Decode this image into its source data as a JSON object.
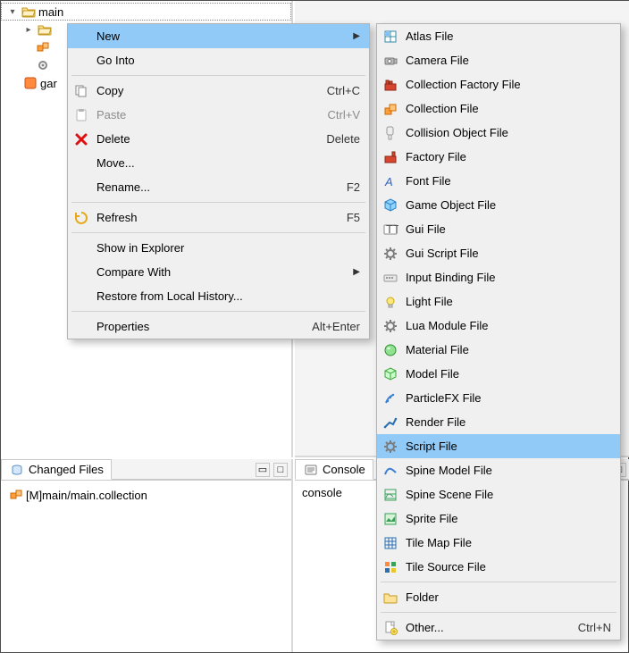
{
  "tree": {
    "main_label": "main",
    "truncated_item": "gar"
  },
  "changed": {
    "title": "Changed Files",
    "item": "[M]main/main.collection"
  },
  "console": {
    "title": "Console",
    "body": "console"
  },
  "menu_a": [
    {
      "kind": "item",
      "icon": "blank",
      "label": "New",
      "accel": "",
      "arrow": true,
      "hl": true
    },
    {
      "kind": "item",
      "icon": "blank",
      "label": "Go Into",
      "accel": "",
      "arrow": false
    },
    {
      "kind": "sep"
    },
    {
      "kind": "item",
      "icon": "copy",
      "label": "Copy",
      "accel": "Ctrl+C",
      "arrow": false
    },
    {
      "kind": "item",
      "icon": "paste",
      "label": "Paste",
      "accel": "Ctrl+V",
      "arrow": false,
      "disabled": true
    },
    {
      "kind": "item",
      "icon": "delete",
      "label": "Delete",
      "accel": "Delete",
      "arrow": false
    },
    {
      "kind": "item",
      "icon": "blank",
      "label": "Move...",
      "accel": "",
      "arrow": false
    },
    {
      "kind": "item",
      "icon": "blank",
      "label": "Rename...",
      "accel": "F2",
      "arrow": false
    },
    {
      "kind": "sep"
    },
    {
      "kind": "item",
      "icon": "refresh",
      "label": "Refresh",
      "accel": "F5",
      "arrow": false
    },
    {
      "kind": "sep"
    },
    {
      "kind": "item",
      "icon": "blank",
      "label": "Show in Explorer",
      "accel": "",
      "arrow": false
    },
    {
      "kind": "item",
      "icon": "blank",
      "label": "Compare With",
      "accel": "",
      "arrow": true
    },
    {
      "kind": "item",
      "icon": "blank",
      "label": "Restore from Local History...",
      "accel": "",
      "arrow": false
    },
    {
      "kind": "sep"
    },
    {
      "kind": "item",
      "icon": "blank",
      "label": "Properties",
      "accel": "Alt+Enter",
      "arrow": false
    }
  ],
  "menu_b": [
    {
      "kind": "item",
      "icon": "atlas",
      "label": "Atlas File"
    },
    {
      "kind": "item",
      "icon": "camera",
      "label": "Camera File"
    },
    {
      "kind": "item",
      "icon": "colfactory",
      "label": "Collection Factory File"
    },
    {
      "kind": "item",
      "icon": "collection",
      "label": "Collection File"
    },
    {
      "kind": "item",
      "icon": "collision",
      "label": "Collision Object File"
    },
    {
      "kind": "item",
      "icon": "factory",
      "label": "Factory File"
    },
    {
      "kind": "item",
      "icon": "font",
      "label": "Font File"
    },
    {
      "kind": "item",
      "icon": "gameobj",
      "label": "Game Object File"
    },
    {
      "kind": "item",
      "icon": "gui",
      "label": "Gui File"
    },
    {
      "kind": "item",
      "icon": "gear",
      "label": "Gui Script File"
    },
    {
      "kind": "item",
      "icon": "input",
      "label": "Input Binding File"
    },
    {
      "kind": "item",
      "icon": "light",
      "label": "Light File"
    },
    {
      "kind": "item",
      "icon": "gear",
      "label": "Lua Module File"
    },
    {
      "kind": "item",
      "icon": "material",
      "label": "Material File"
    },
    {
      "kind": "item",
      "icon": "model",
      "label": "Model File"
    },
    {
      "kind": "item",
      "icon": "particle",
      "label": "ParticleFX File"
    },
    {
      "kind": "item",
      "icon": "render",
      "label": "Render File"
    },
    {
      "kind": "item",
      "icon": "gear",
      "label": "Script File",
      "hl": true
    },
    {
      "kind": "item",
      "icon": "spine",
      "label": "Spine Model File"
    },
    {
      "kind": "item",
      "icon": "spinescene",
      "label": "Spine Scene File"
    },
    {
      "kind": "item",
      "icon": "sprite",
      "label": "Sprite File"
    },
    {
      "kind": "item",
      "icon": "tilemap",
      "label": "Tile Map File"
    },
    {
      "kind": "item",
      "icon": "tilesource",
      "label": "Tile Source File"
    },
    {
      "kind": "sep"
    },
    {
      "kind": "item",
      "icon": "folder",
      "label": "Folder"
    },
    {
      "kind": "sep"
    },
    {
      "kind": "item",
      "icon": "other",
      "label": "Other...",
      "accel": "Ctrl+N"
    }
  ]
}
